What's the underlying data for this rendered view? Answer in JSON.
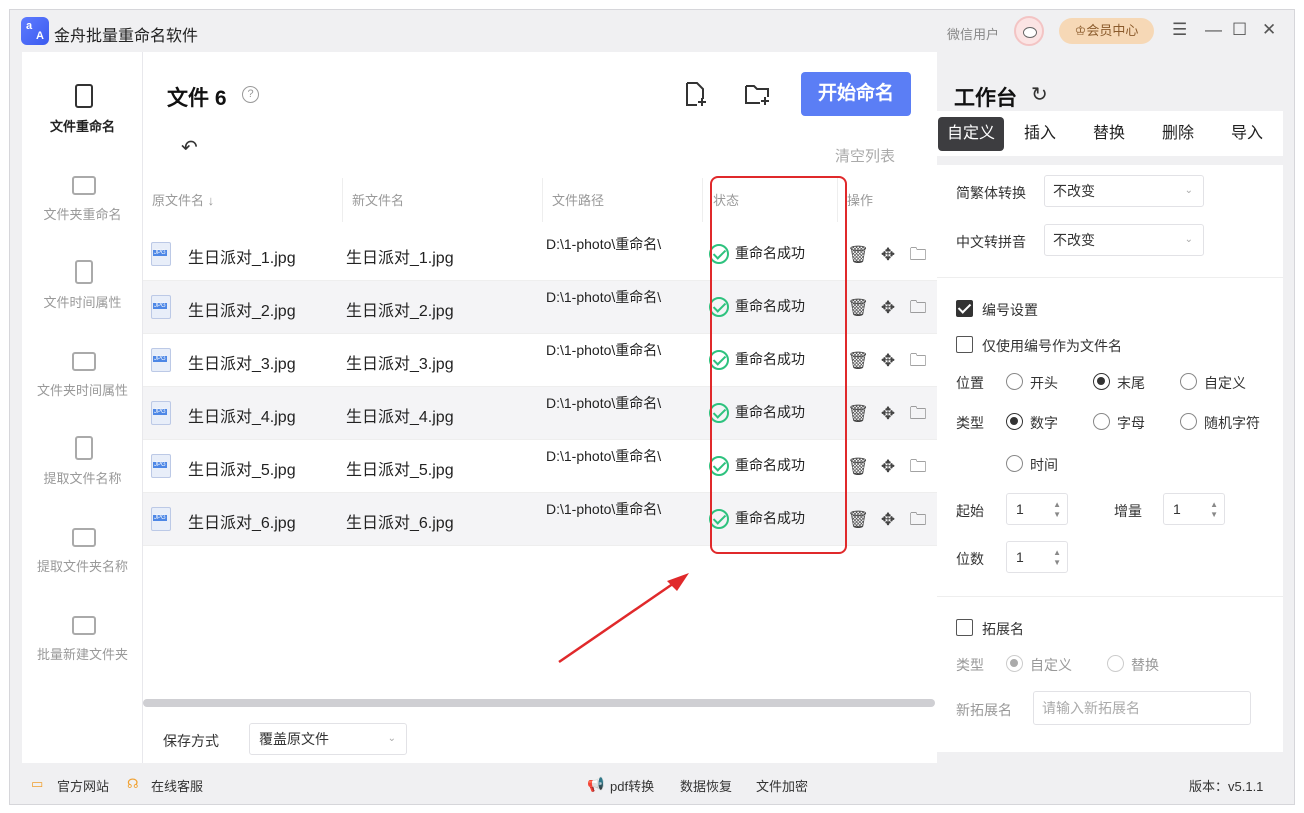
{
  "app": {
    "title": "金舟批量重命名软件",
    "logo_letters": [
      "a",
      "A"
    ],
    "user": "微信用户",
    "vip_label": "会员中心",
    "win_controls": [
      "☰",
      "—",
      "☐",
      "✕"
    ]
  },
  "sidebar": {
    "items": [
      {
        "label": "文件重命名",
        "icon": "file-edit-icon",
        "active": true
      },
      {
        "label": "文件夹重命名",
        "icon": "folder-edit-icon"
      },
      {
        "label": "文件时间属性",
        "icon": "file-clock-icon"
      },
      {
        "label": "文件夹时间属性",
        "icon": "folder-clock-icon"
      },
      {
        "label": "提取文件名称",
        "icon": "file-extract-icon"
      },
      {
        "label": "提取文件夹名称",
        "icon": "folder-extract-icon"
      },
      {
        "label": "批量新建文件夹",
        "icon": "folder-new-icon"
      }
    ]
  },
  "main": {
    "file_count_label": "文件 6",
    "help": "?",
    "start_button": "开始命名",
    "clear_list": "清空列表",
    "undo": "↶",
    "columns": [
      "原文件名",
      "新文件名",
      "文件路径",
      "状态",
      "操作"
    ],
    "sort_arrow": "↓",
    "rows": [
      {
        "orig": "生日派对_1.jpg",
        "new": "生日派对_1.jpg",
        "path": "D:\\1-photo\\重命名\\",
        "status": "重命名成功"
      },
      {
        "orig": "生日派对_2.jpg",
        "new": "生日派对_2.jpg",
        "path": "D:\\1-photo\\重命名\\",
        "status": "重命名成功"
      },
      {
        "orig": "生日派对_3.jpg",
        "new": "生日派对_3.jpg",
        "path": "D:\\1-photo\\重命名\\",
        "status": "重命名成功"
      },
      {
        "orig": "生日派对_4.jpg",
        "new": "生日派对_4.jpg",
        "path": "D:\\1-photo\\重命名\\",
        "status": "重命名成功"
      },
      {
        "orig": "生日派对_5.jpg",
        "new": "生日派对_5.jpg",
        "path": "D:\\1-photo\\重命名\\",
        "status": "重命名成功"
      },
      {
        "orig": "生日派对_6.jpg",
        "new": "生日派对_6.jpg",
        "path": "D:\\1-photo\\重命名\\",
        "status": "重命名成功"
      }
    ],
    "save_label": "保存方式",
    "save_value": "覆盖原文件"
  },
  "workbench": {
    "title": "工作台",
    "tabs": [
      "自定义",
      "插入",
      "替换",
      "删除",
      "导入"
    ],
    "trad_simp_label": "简繁体转换",
    "trad_simp_value": "不改变",
    "pinyin_label": "中文转拼音",
    "pinyin_value": "不改变",
    "numbering_label": "编号设置",
    "numbering_checked": true,
    "only_number_label": "仅使用编号作为文件名",
    "only_number_checked": false,
    "position_label": "位置",
    "position_options": [
      "开头",
      "末尾",
      "自定义"
    ],
    "position_selected": "末尾",
    "type_label": "类型",
    "type_options": [
      "数字",
      "字母",
      "随机字符",
      "时间"
    ],
    "type_selected": "数字",
    "start_label": "起始",
    "start_value": "1",
    "step_label": "增量",
    "step_value": "1",
    "digits_label": "位数",
    "digits_value": "1",
    "ext_label": "拓展名",
    "ext_checked": false,
    "ext_type_label": "类型",
    "ext_type_options": [
      "自定义",
      "替换"
    ],
    "ext_type_selected": "自定义",
    "new_ext_label": "新拓展名",
    "new_ext_placeholder": "请输入新拓展名"
  },
  "footer": {
    "website": "官方网站",
    "support": "在线客服",
    "links": [
      "pdf转换",
      "数据恢复",
      "文件加密"
    ],
    "version": "版本：v5.1.1"
  }
}
